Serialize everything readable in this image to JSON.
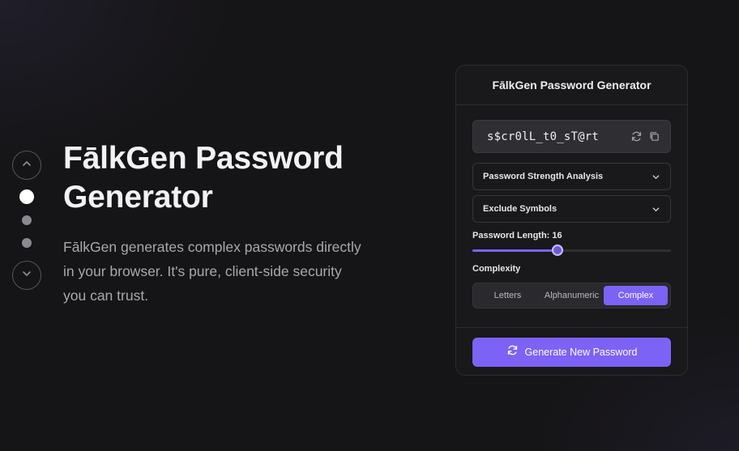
{
  "hero": {
    "title": "FālkGen Password Generator",
    "description": "FālkGen generates complex passwords directly in your browser. It's pure, client-side security you can trust."
  },
  "slide_nav": {
    "up_icon": "chevron-up-icon",
    "down_icon": "chevron-down-icon",
    "dot_count": 3,
    "active_dot": 1
  },
  "generator": {
    "title": "FālkGen Password Generator",
    "password": "s$cr0lL_t0_sT@rt",
    "refresh_icon": "refresh-icon",
    "copy_icon": "copy-icon",
    "strength_label": "Password Strength Analysis",
    "exclude_label": "Exclude Symbols",
    "length_label": "Password Length: 16",
    "length_value": 16,
    "length_fraction": 0.43,
    "complexity_label": "Complexity",
    "complexity_options": [
      "Letters",
      "Alphanumeric",
      "Complex"
    ],
    "complexity_selected": "Complex",
    "generate_label": "Generate New Password"
  },
  "colors": {
    "background": "#151416",
    "card": "#19181b",
    "accent": "#7c62f5",
    "text_primary": "#f2f2f4",
    "text_muted": "#a9a8ae"
  }
}
